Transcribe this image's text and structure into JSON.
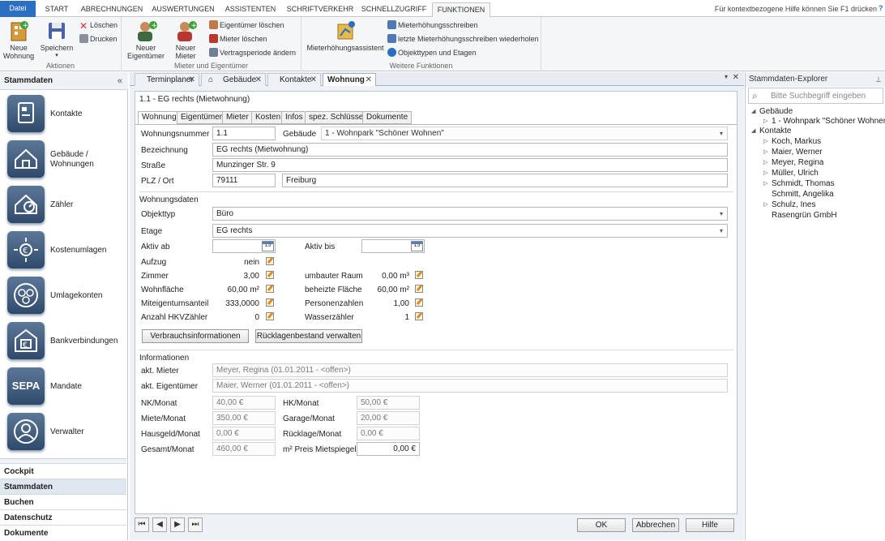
{
  "ribbon_tabs": [
    "Datei",
    "START",
    "ABRECHNUNGEN",
    "AUSWERTUNGEN",
    "ASSISTENTEN",
    "SCHRIFTVERKEHR",
    "SCHNELLZUGRIFF",
    "FUNKTIONEN"
  ],
  "help_hint": "Für kontextbezogene Hilfe können Sie F1 drücken",
  "help_icon": "?",
  "ribbon": {
    "group_aktionen": {
      "label": "Aktionen",
      "neue_wohnung": "Neue Wohnung",
      "speichern": "Speichern",
      "loeschen": "Löschen",
      "drucken": "Drucken"
    },
    "group_mieter": {
      "label": "Mieter und Eigentümer",
      "neuer_eigentuemer": "Neuer Eigentümer",
      "neuer_mieter": "Neuer Mieter",
      "eigentuemer_loeschen": "Eigentümer löschen",
      "mieter_loeschen": "Mieter löschen",
      "vertragsperiode": "Vertragsperiode ändern"
    },
    "group_weitere": {
      "label": "Weitere Funktionen",
      "assistent": "Mieterhöhungsassistent",
      "mieterhoehungsschreiben": "Mieterhöhungsschreiben",
      "letzte": "letzte Mieterhöhungsschreiben wiederholen",
      "objekttypen": "Objekttypen und Etagen"
    }
  },
  "left_panel": {
    "title": "Stammdaten",
    "collapse_glyph": "«",
    "items": [
      {
        "label": "Kontakte"
      },
      {
        "label": "Gebäude /\nWohnungen"
      },
      {
        "label": "Zähler"
      },
      {
        "label": "Kostenumlagen"
      },
      {
        "label": "Umlagekonten"
      },
      {
        "label": "Bankverbindungen"
      },
      {
        "label": "Mandate"
      },
      {
        "label": "Verwalter"
      }
    ],
    "sepa_glyph": "SEPA",
    "bottom": [
      "Cockpit",
      "Stammdaten",
      "Buchen",
      "Datenschutz",
      "Dokumente"
    ]
  },
  "doc_tabs": [
    "Terminplaner",
    "Gebäude",
    "Kontakte",
    "Wohnung"
  ],
  "record_title": "1.1 - EG rechts (Mietwohnung)",
  "inner_tabs": [
    "Wohnung",
    "Eigentümer",
    "Mieter",
    "Kosten",
    "Infos",
    "spez. Schlüssel",
    "Dokumente"
  ],
  "form": {
    "wohnungsnummer_label": "Wohnungsnummer",
    "wohnungsnummer": "1.1",
    "gebaeude_label": "Gebäude",
    "gebaeude": "1 - Wohnpark \"Schöner Wohnen\"",
    "bezeichnung_label": "Bezeichnung",
    "bezeichnung": "EG rechts (Mietwohnung)",
    "strasse_label": "Straße",
    "strasse": "Munzinger Str. 9",
    "plz_label": "PLZ / Ort",
    "plz": "79111",
    "ort": "Freiburg",
    "section_wohnungsdaten": "Wohnungsdaten",
    "objekttyp_label": "Objekttyp",
    "objekttyp": "Büro",
    "etage_label": "Etage",
    "etage": "EG rechts",
    "aktiv_ab_label": "Aktiv ab",
    "aktiv_bis_label": "Aktiv bis",
    "cal_day": "15",
    "aufzug_label": "Aufzug",
    "aufzug": "nein",
    "zimmer_label": "Zimmer",
    "zimmer": "3,00",
    "umbauter_raum_label": "umbauter Raum",
    "umbauter_raum": "0,00 m³",
    "wohnflaeche_label": "Wohnfläche",
    "wohnflaeche": "60,00 m²",
    "beheizte_label": "beheizte Fläche",
    "beheizte": "60,00 m²",
    "miteigentum_label": "Miteigentumsanteil",
    "miteigentum": "333,0000",
    "personen_label": "Personenzahlen",
    "personen": "1,00",
    "hkv_label": "Anzahl HKVZähler",
    "hkv": "0",
    "wasser_label": "Wasserzähler",
    "wasser": "1",
    "btn_verbrauch": "Verbrauchsinformationen",
    "btn_ruecklagen": "Rücklagenbestand verwalten",
    "section_info": "Informationen",
    "akt_mieter_label": "akt. Mieter",
    "akt_mieter": "Meyer, Regina (01.01.2011 - <offen>)",
    "akt_eigentuemer_label": "akt. Eigentümer",
    "akt_eigentuemer": "Maier, Werner (01.01.2011 - <offen>)",
    "nk_label": "NK/Monat",
    "nk": "40,00 €",
    "hk_label": "HK/Monat",
    "hk": "50,00 €",
    "miete_label": "Miete/Monat",
    "miete": "350,00 €",
    "garage_label": "Garage/Monat",
    "garage": "20,00 €",
    "hausgeld_label": "Hausgeld/Monat",
    "hausgeld": "0,00 €",
    "ruecklage_label": "Rücklage/Monat",
    "ruecklage": "0,00 €",
    "gesamt_label": "Gesamt/Monat",
    "gesamt": "460,00 €",
    "qm_preis_label": "m² Preis Mietspiegel",
    "qm_preis": "0,00 €"
  },
  "footer_buttons": {
    "ok": "OK",
    "abbrechen": "Abbrechen",
    "hilfe": "Hilfe"
  },
  "right_panel": {
    "title": "Stammdaten-Explorer",
    "search_placeholder": "Bitte Suchbegriff eingeben",
    "tree": {
      "gebaeude": "Gebäude",
      "gebaeude_child": "1 - Wohnpark \"Schöner Wohnen\"",
      "kontakte": "Kontakte",
      "contacts": [
        "Koch, Markus",
        "Maier, Werner",
        "Meyer, Regina",
        "Müller, Ulrich",
        "Schmidt, Thomas",
        "Schmitt, Angelika",
        "Schulz, Ines",
        "Rasengrün GmbH"
      ]
    }
  }
}
